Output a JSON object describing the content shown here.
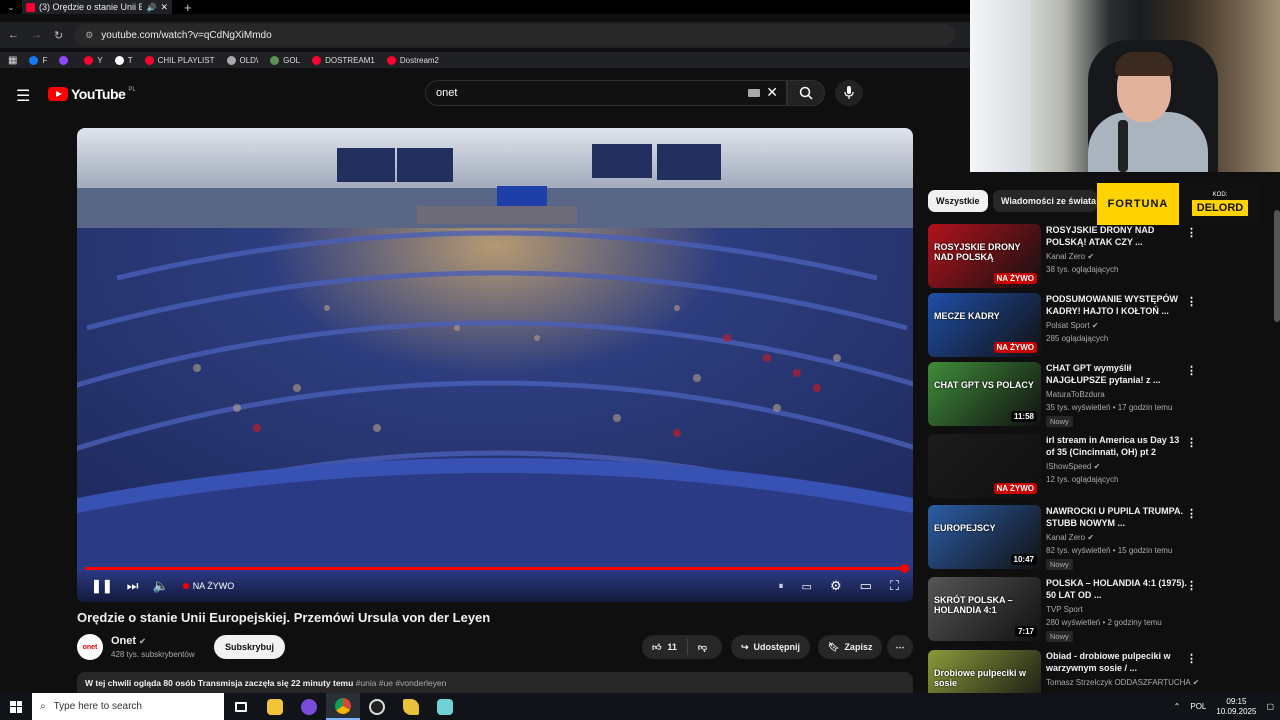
{
  "browser": {
    "tab_title": "(3) Orędzie o stanie Unii Eu",
    "url": "youtube.com/watch?v=qCdNgXiMmdo",
    "bookmarks": [
      {
        "label": "F",
        "color": "#1877f2"
      },
      {
        "label": "",
        "color": "#9146ff"
      },
      {
        "label": "Y",
        "color": "#ff0033"
      },
      {
        "label": "T",
        "color": "#ffffff"
      },
      {
        "label": "CHIL PLAYLIST",
        "color": "#ff0033"
      },
      {
        "label": "OLD\\",
        "color": "#aaaaaa"
      },
      {
        "label": "GOL",
        "color": "#5a8f5a"
      },
      {
        "label": "DOSTREAM1",
        "color": "#ff0033"
      },
      {
        "label": "Dostream2",
        "color": "#ff0033"
      }
    ]
  },
  "youtube": {
    "logo_text": "YouTube",
    "logo_region": "PL",
    "search_value": "onet"
  },
  "player": {
    "live_label": "NA ŻYWO"
  },
  "video": {
    "title": "Orędzie o stanie Unii Europejskiej. Przemówi Ursula von der Leyen",
    "channel_name": "Onet",
    "channel_avatar_text": "onet",
    "subscribers": "428 tys. subskrybentów",
    "subscribe_label": "Subskrybuj",
    "likes": "11",
    "share_label": "Udostępnij",
    "save_label": "Zapisz",
    "description_line": "W tej chwili ogląda 80 osób  Transmisja zaczęła się 22 minuty temu",
    "description_tags": "#unia #ue #vonderleyen"
  },
  "sponsor": {
    "brand": "FORTUNA",
    "kod_label": "KOD:",
    "kod_code": "DELORD"
  },
  "sidebar": {
    "chips": [
      "Wszystkie",
      "Wiadomości ze świata"
    ],
    "recommendations": [
      {
        "title": "ROSYJSKIE DRONY NAD POLSKĄ! ATAK CZY ...",
        "channel": "Kanal Zero",
        "verified": true,
        "meta": "38 tys. oglądających",
        "badge": "NA ŻYWO",
        "live": true,
        "new": "",
        "thumb_text": "ROSYJSKIE DRONY NAD POLSKĄ",
        "thumb_color": "#b3121c"
      },
      {
        "title": "PODSUMOWANIE WYSTĘPÓW KADRY! HAJTO I KOŁTOŃ ...",
        "channel": "Polsat Sport",
        "verified": true,
        "meta": "285 oglądających",
        "badge": "NA ŻYWO",
        "live": true,
        "new": "",
        "thumb_text": "MECZE KADRY",
        "thumb_color": "#1f4fa8"
      },
      {
        "title": "CHAT GPT wymyślił NAJGŁUPSZE pytania! z ...",
        "channel": "MaturaToBzdura",
        "verified": false,
        "meta": "35 tys. wyświetleń • 17 godzin temu",
        "badge": "11:58",
        "live": false,
        "new": "Nowy",
        "thumb_text": "CHAT GPT VS POLACY",
        "thumb_color": "#3f8c3a"
      },
      {
        "title": "irl stream in America us Day 13 of 35 (Cincinnati, OH) pt 2",
        "channel": "IShowSpeed",
        "verified": true,
        "meta": "12 tys. oglądających",
        "badge": "NA ŻYWO",
        "live": true,
        "new": "",
        "thumb_text": "",
        "thumb_color": "#1b1b1b"
      },
      {
        "title": "NAWROCKI U PUPILA TRUMPA. STUBB NOWYM ...",
        "channel": "Kanal Zero",
        "verified": true,
        "meta": "82 tys. wyświetleń • 15 godzin temu",
        "badge": "10:47",
        "live": false,
        "new": "Nowy",
        "thumb_text": "EUROPEJSCY",
        "thumb_color": "#2c5da8"
      },
      {
        "title": "POLSKA – HOLANDIA 4:1 (1975). 50 LAT OD ...",
        "channel": "TVP Sport",
        "verified": false,
        "meta": "280 wyświetleń • 2 godziny temu",
        "badge": "7:17",
        "live": false,
        "new": "Nowy",
        "thumb_text": "SKRÓT POLSKA – HOLANDIA 4:1",
        "thumb_color": "#555555"
      },
      {
        "title": "Obiad - drobiowe pulpeciki w warzywnym sosie / ...",
        "channel": "Tomasz Strzelczyk ODDASZFARTUCHA",
        "verified": true,
        "meta": "",
        "badge": "",
        "live": false,
        "new": "",
        "thumb_text": "Drobiowe pulpeciki w sosie",
        "thumb_color": "#8a9a3a"
      }
    ]
  },
  "taskbar": {
    "search_placeholder": "Type here to search",
    "lang": "POL",
    "time": "09:15",
    "date": "10.09.2025"
  }
}
